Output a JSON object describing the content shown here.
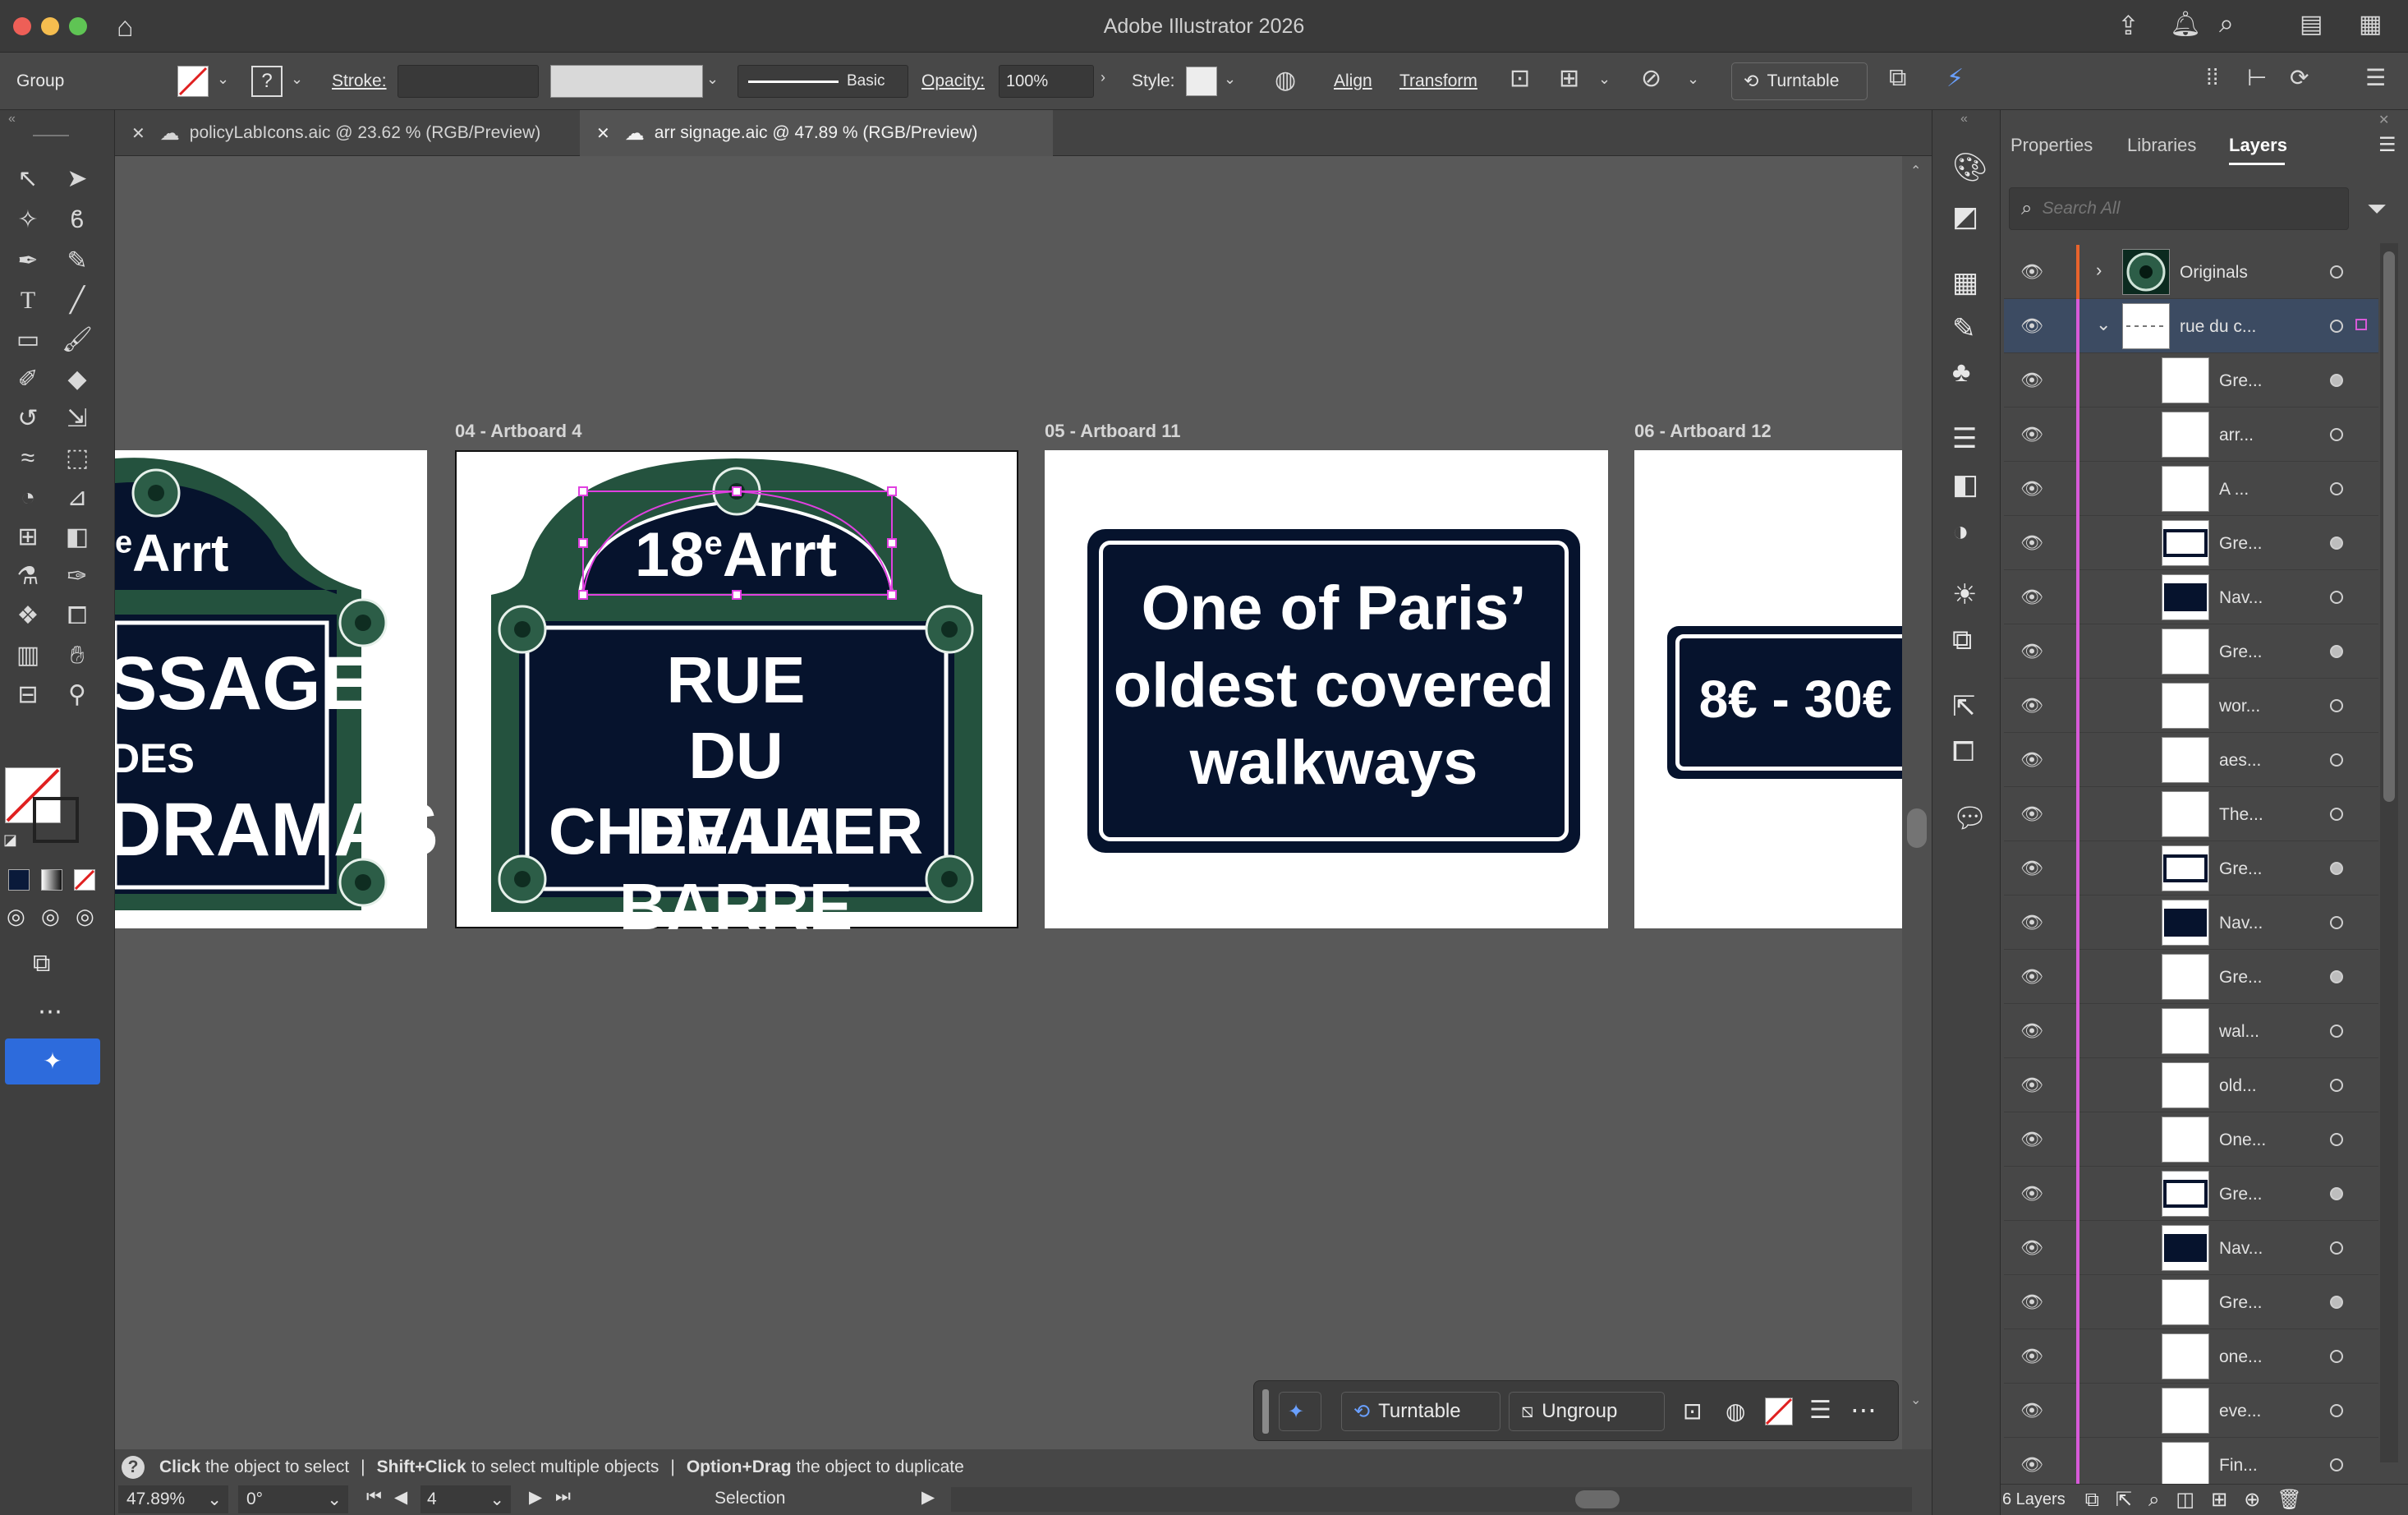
{
  "app": {
    "title": "Adobe Illustrator 2026"
  },
  "colors": {
    "sign_navy": "#06132d",
    "sign_green": "#24523e",
    "selection": "#e040e0",
    "accent_blue": "#2d6bdc",
    "layer_red": "#e8632c",
    "layer_magenta": "#d75ad8"
  },
  "control_bar": {
    "selection_type": "Group",
    "stroke_label": "Stroke:",
    "stroke_style": "Basic",
    "opacity_label": "Opacity:",
    "opacity_value": "100%",
    "style_label": "Style:",
    "align": "Align",
    "transform": "Transform",
    "turntable": "Turntable"
  },
  "tabs": [
    {
      "label": "policyLabIcons.aic @ 23.62 % (RGB/Preview)"
    },
    {
      "label": "arr signage.aic @ 47.89 % (RGB/Preview)"
    }
  ],
  "artboards": [
    {
      "label": "",
      "sign": {
        "top_line": "e",
        "arr": "Arrt",
        "lines": [
          "SSAGE",
          "DES",
          "DRAMAS"
        ]
      }
    },
    {
      "label": "04 - Artboard 4",
      "sign": {
        "top_line": "18",
        "sup": "e",
        "arr": "Arrt",
        "lines": [
          "RUE",
          "DU CHEVALIER",
          "DE LA BARRE"
        ]
      }
    },
    {
      "label": "05 - Artboard 11",
      "sign": {
        "lines": [
          "One of Paris’",
          "oldest covered",
          "walkways"
        ]
      }
    },
    {
      "label": "06 - Artboard 12",
      "sign": {
        "lines": [
          "8€ - 30€"
        ]
      }
    }
  ],
  "panel": {
    "tabs": [
      "Properties",
      "Libraries",
      "Layers"
    ],
    "active_tab": "Layers",
    "search_placeholder": "Search All",
    "layers": [
      {
        "name": "Originals",
        "level": 0,
        "thumb": "sign",
        "expanded": false
      },
      {
        "name": "rue du c...",
        "level": 0,
        "thumb": "dash",
        "expanded": true,
        "selected": true
      },
      {
        "name": "Gre...",
        "level": 1,
        "thumb": "white",
        "filled": true
      },
      {
        "name": "arr...",
        "level": 1,
        "thumb": "white"
      },
      {
        "name": "A ...",
        "level": 1,
        "thumb": "white"
      },
      {
        "name": "Gre...",
        "level": 1,
        "thumb": "frame",
        "filled": true
      },
      {
        "name": "Nav...",
        "level": 1,
        "thumb": "navy"
      },
      {
        "name": "Gre...",
        "level": 1,
        "thumb": "white",
        "filled": true
      },
      {
        "name": "wor...",
        "level": 1,
        "thumb": "white"
      },
      {
        "name": "aes...",
        "level": 1,
        "thumb": "white"
      },
      {
        "name": "The...",
        "level": 1,
        "thumb": "white"
      },
      {
        "name": "Gre...",
        "level": 1,
        "thumb": "frame",
        "filled": true
      },
      {
        "name": "Nav...",
        "level": 1,
        "thumb": "navy"
      },
      {
        "name": "Gre...",
        "level": 1,
        "thumb": "white",
        "filled": true
      },
      {
        "name": "wal...",
        "level": 1,
        "thumb": "white"
      },
      {
        "name": "old...",
        "level": 1,
        "thumb": "white"
      },
      {
        "name": "One...",
        "level": 1,
        "thumb": "white"
      },
      {
        "name": "Gre...",
        "level": 1,
        "thumb": "frame",
        "filled": true
      },
      {
        "name": "Nav...",
        "level": 1,
        "thumb": "navy"
      },
      {
        "name": "Gre...",
        "level": 1,
        "thumb": "white",
        "filled": true
      },
      {
        "name": "one...",
        "level": 1,
        "thumb": "white"
      },
      {
        "name": "eve...",
        "level": 1,
        "thumb": "white"
      },
      {
        "name": "Fin...",
        "level": 1,
        "thumb": "white"
      }
    ],
    "footer_count": "6 Layers"
  },
  "task_bar": {
    "turntable": "Turntable",
    "ungroup": "Ungroup"
  },
  "status": {
    "hint_click": "Click",
    "hint_click_rest": "the object to select",
    "hint_shift": "Shift+Click",
    "hint_shift_rest": "to select multiple objects",
    "hint_option": "Option+Drag",
    "hint_option_rest": "the object to duplicate",
    "zoom": "47.89%",
    "rotation": "0°",
    "artboard_num": "4",
    "tool": "Selection"
  }
}
